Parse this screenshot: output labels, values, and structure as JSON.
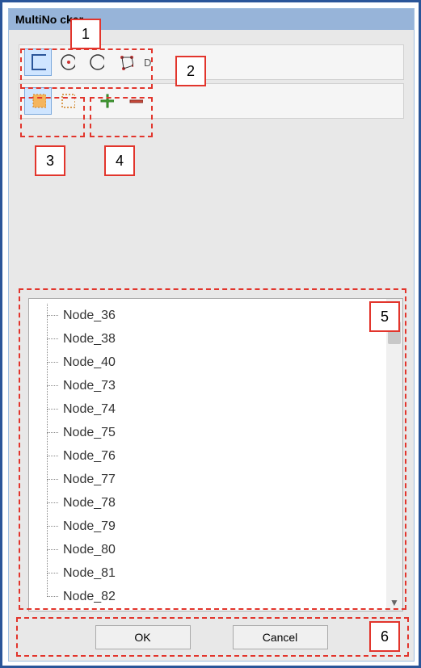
{
  "window": {
    "title": "MultiNodePicker",
    "title_visible": "MultiNo          cker"
  },
  "toolbar1": {
    "tools": [
      "rect-select",
      "circle-point",
      "circle-outline",
      "polygon"
    ],
    "label": "D"
  },
  "toolbar2": {
    "tools": [
      "select-inside",
      "select-outside",
      "add",
      "remove"
    ]
  },
  "tree": {
    "items": [
      "Node_36",
      "Node_38",
      "Node_40",
      "Node_73",
      "Node_74",
      "Node_75",
      "Node_76",
      "Node_77",
      "Node_78",
      "Node_79",
      "Node_80",
      "Node_81",
      "Node_82"
    ]
  },
  "buttons": {
    "ok": "OK",
    "cancel": "Cancel"
  },
  "callouts": [
    "1",
    "2",
    "3",
    "4",
    "5",
    "6"
  ]
}
